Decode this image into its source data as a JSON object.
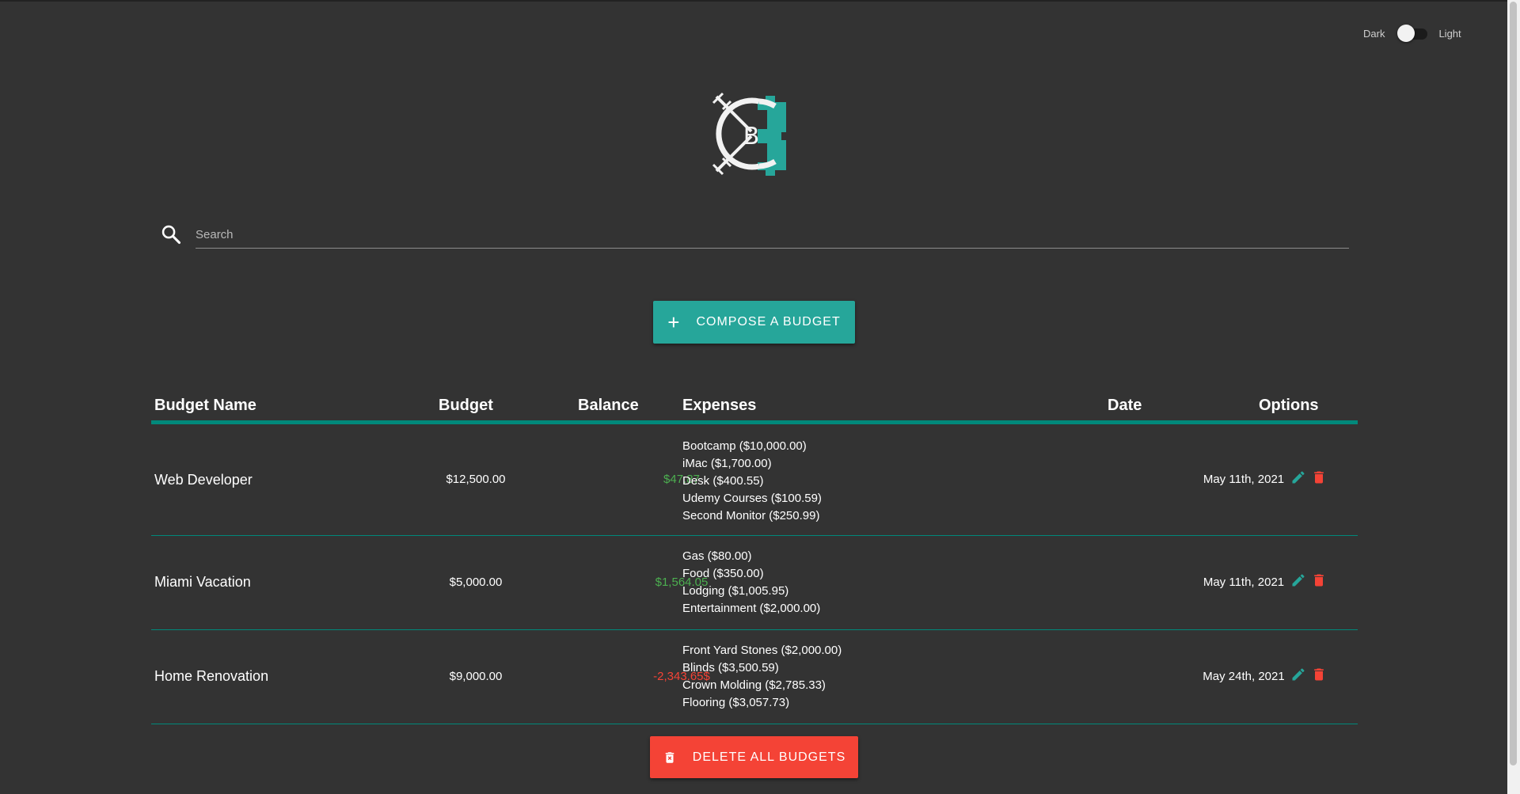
{
  "theme_toggle": {
    "left_label": "Dark",
    "right_label": "Light",
    "state": "dark"
  },
  "logo": {
    "letter": "B",
    "accent_color": "#26a69a"
  },
  "search": {
    "placeholder": "Search",
    "value": "",
    "icon": "search-icon"
  },
  "compose_button": {
    "label": "COMPOSE A BUDGET",
    "icon": "plus-icon",
    "color": "#26a69a"
  },
  "table": {
    "headers": {
      "name": "Budget Name",
      "budget": "Budget",
      "balance": "Balance",
      "expenses": "Expenses",
      "date": "Date",
      "options": "Options"
    },
    "rows": [
      {
        "name": "Web Developer",
        "budget": "$12,500.00",
        "balance": "$47.87",
        "balance_status": "positive",
        "expenses": [
          "Bootcamp ($10,000.00)",
          "iMac ($1,700.00)",
          "Desk ($400.55)",
          "Udemy Courses ($100.59)",
          "Second Monitor ($250.99)"
        ],
        "date": "May 11th, 2021"
      },
      {
        "name": "Miami Vacation",
        "budget": "$5,000.00",
        "balance": "$1,564.05",
        "balance_status": "positive",
        "expenses": [
          "Gas ($80.00)",
          "Food ($350.00)",
          "Lodging ($1,005.95)",
          "Entertainment ($2,000.00)"
        ],
        "date": "May 11th, 2021"
      },
      {
        "name": "Home Renovation",
        "budget": "$9,000.00",
        "balance": "-2,343.65$",
        "balance_status": "negative",
        "expenses": [
          "Front Yard Stones ($2,000.00)",
          "Blinds ($3,500.59)",
          "Crown Molding ($2,785.33)",
          "Flooring ($3,057.73)"
        ],
        "date": "May 24th, 2021"
      }
    ],
    "row_icons": {
      "edit": "pencil-icon",
      "delete": "trash-icon"
    }
  },
  "delete_all_button": {
    "label": "DELETE ALL BUDGETS",
    "icon": "trash-icon",
    "color": "#f44336"
  },
  "colors": {
    "background": "#333333",
    "accent": "#26a69a",
    "positive": "#4caf50",
    "negative": "#f44336"
  }
}
